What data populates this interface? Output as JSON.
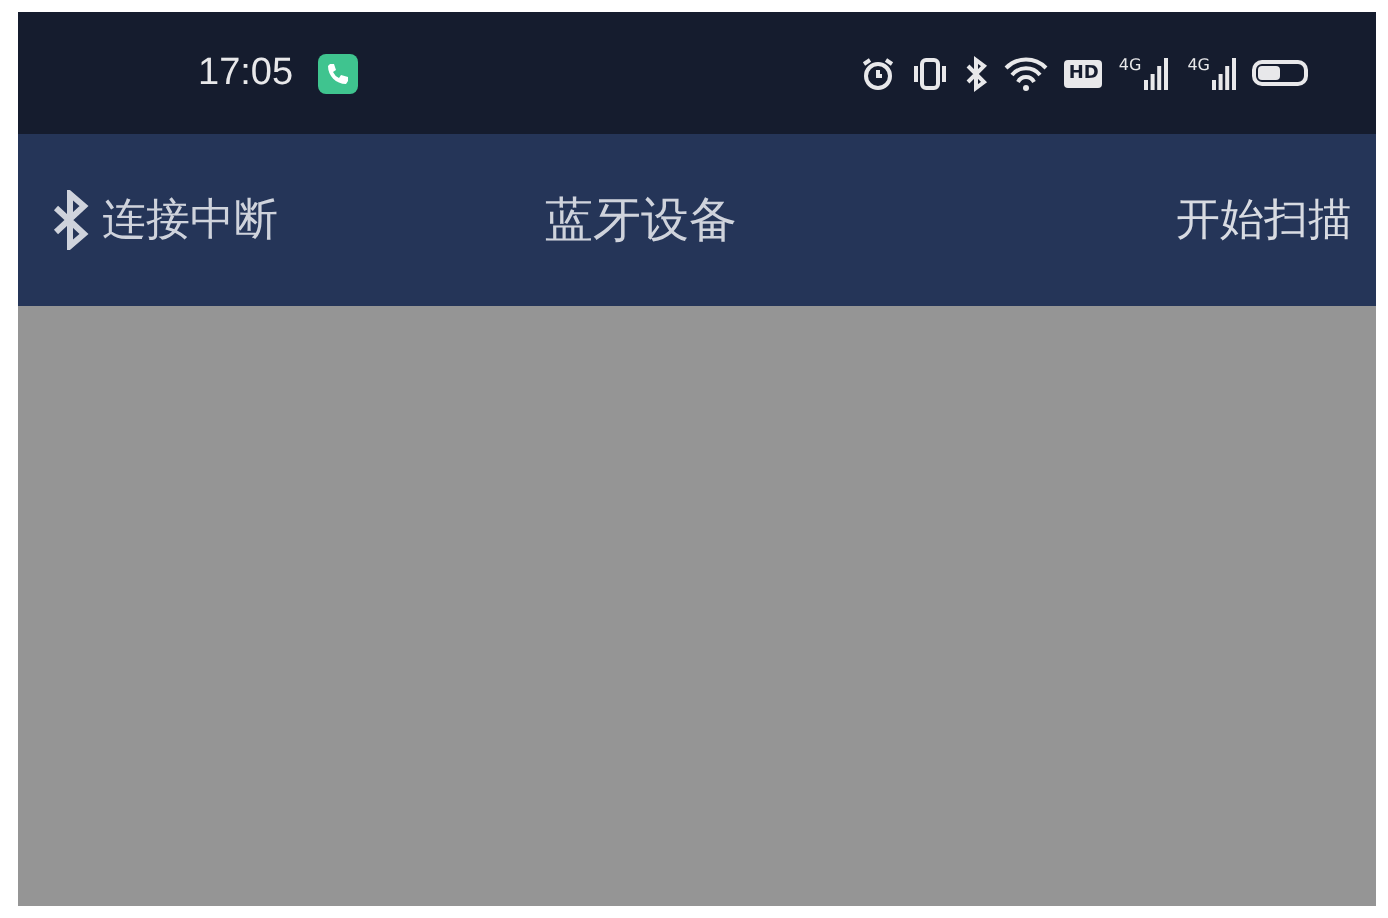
{
  "status_bar": {
    "time": "17:05",
    "hd_badge": "HD",
    "signals": [
      {
        "label": "4G"
      },
      {
        "label": "4G"
      }
    ]
  },
  "app_bar": {
    "connection_status": "连接中断",
    "title": "蓝牙设备",
    "action": "开始扫描"
  }
}
